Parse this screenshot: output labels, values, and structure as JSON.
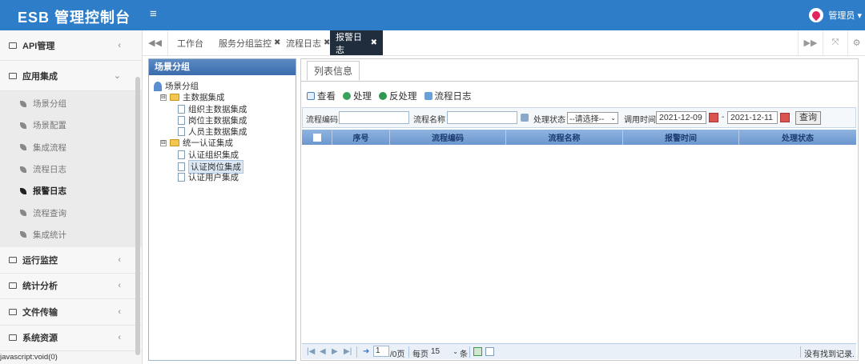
{
  "header": {
    "title": "ESB 管理控制台",
    "menu_icon": "≡",
    "user": "管理员 ▾",
    "user_icon": "location-pin-icon"
  },
  "sidebar": {
    "groups": [
      {
        "label": "API管理",
        "arrow": "‹"
      },
      {
        "label": "应用集成",
        "arrow": "⌄"
      }
    ],
    "sub_items": [
      "场景分组",
      "场景配置",
      "集成流程",
      "流程日志",
      "报警日志",
      "流程查询",
      "集成统计"
    ],
    "active_sub": "报警日志",
    "groups_after": [
      {
        "label": "运行监控",
        "arrow": "‹"
      },
      {
        "label": "统计分析",
        "arrow": "‹"
      },
      {
        "label": "文件传输",
        "arrow": "‹"
      },
      {
        "label": "系统资源",
        "arrow": "‹"
      }
    ]
  },
  "status_bar": "javascript:void(0)",
  "tabs": {
    "left_arrow": "◀◀",
    "items": [
      {
        "label": "工作台",
        "close": ""
      },
      {
        "label": "服务分组监控",
        "close": "✖"
      },
      {
        "label": "流程日志",
        "close": "✖"
      },
      {
        "label": "报警日志",
        "close": "✖"
      }
    ],
    "right_arrow": "▶▶",
    "expand": "⤧",
    "settings": "⚙"
  },
  "tree": {
    "header": "场景分组",
    "root": "场景分组",
    "n1": "主数据集成",
    "n1a": "组织主数据集成",
    "n1b": "岗位主数据集成",
    "n1c": "人员主数据集成",
    "n2": "统一认证集成",
    "n2a": "认证组织集成",
    "n2b": "认证岗位集成",
    "n2c": "认证用户集成",
    "collapse": "⊟"
  },
  "panel": {
    "tab": "列表信息"
  },
  "toolbar": [
    "查看",
    "处理",
    "反处理",
    "流程日志"
  ],
  "search": {
    "code_label": "流程编码",
    "name_label": "流程名称",
    "status_label": "处理状态",
    "status_value": "--请选择--",
    "time_label": "调用时间",
    "date_from": "2021-12-09",
    "dash": "-",
    "date_to": "2021-12-11",
    "query": "查询"
  },
  "grid": {
    "columns": [
      "序号",
      "流程编码",
      "流程名称",
      "报警时间",
      "处理状态"
    ]
  },
  "pager": {
    "first": "|◀",
    "prev": "◀",
    "next": "▶",
    "last": "▶|",
    "go": "➜",
    "page": "1",
    "of": "/0页",
    "per_page_label": "每页",
    "per_page": "15",
    "unit": "条",
    "empty": "没有找到记录."
  },
  "colors": {
    "header_bg": "#2d7dc8",
    "active_tab_bg": "#1f2d3d"
  }
}
